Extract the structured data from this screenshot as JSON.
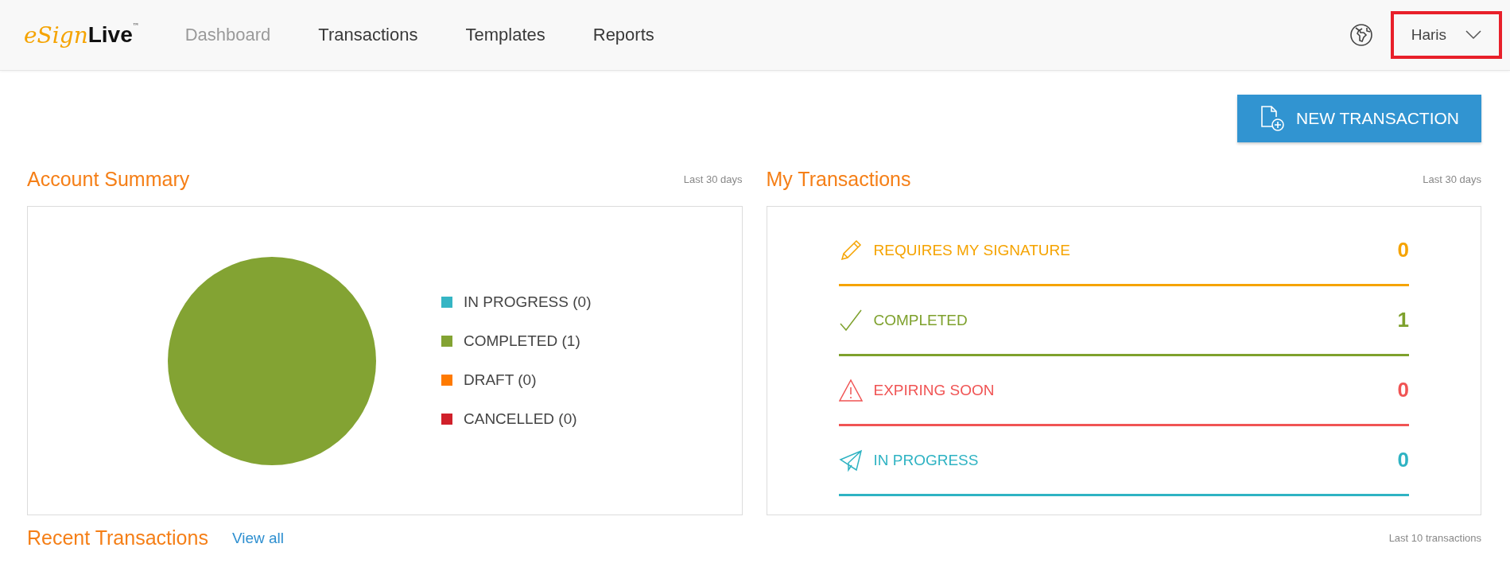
{
  "header": {
    "logo": {
      "prefix": "eSign",
      "suffix": "Live",
      "mark": "™"
    },
    "nav": [
      {
        "label": "Dashboard",
        "selected": true
      },
      {
        "label": "Transactions",
        "selected": false
      },
      {
        "label": "Templates",
        "selected": false
      },
      {
        "label": "Reports",
        "selected": false
      }
    ],
    "user_menu": {
      "name": "Haris",
      "highlighted": true
    }
  },
  "new_transaction_button": "NEW TRANSACTION",
  "account_summary": {
    "title": "Account Summary",
    "period": "Last 30 days",
    "chart_data": {
      "type": "pie",
      "categories": [
        "IN PROGRESS (0)",
        "COMPLETED (1)",
        "DRAFT (0)",
        "CANCELLED (0)"
      ],
      "values": [
        0,
        1,
        0,
        0
      ],
      "colors": [
        "#35b5c4",
        "#83a333",
        "#ff7a00",
        "#d0202a"
      ]
    }
  },
  "my_transactions": {
    "title": "My Transactions",
    "period": "Last 30 days",
    "rows": [
      {
        "kind": "signature",
        "label": "REQUIRES MY SIGNATURE",
        "count": "0",
        "color": "#f5a300"
      },
      {
        "kind": "completed",
        "label": "COMPLETED",
        "count": "1",
        "color": "#7ea12d"
      },
      {
        "kind": "expiring",
        "label": "EXPIRING SOON",
        "count": "0",
        "color": "#f05454"
      },
      {
        "kind": "progress",
        "label": "IN PROGRESS",
        "count": "0",
        "color": "#2fb3c3"
      }
    ]
  },
  "recent_transactions": {
    "title": "Recent Transactions",
    "link": "View all",
    "period": "Last 10 transactions"
  }
}
